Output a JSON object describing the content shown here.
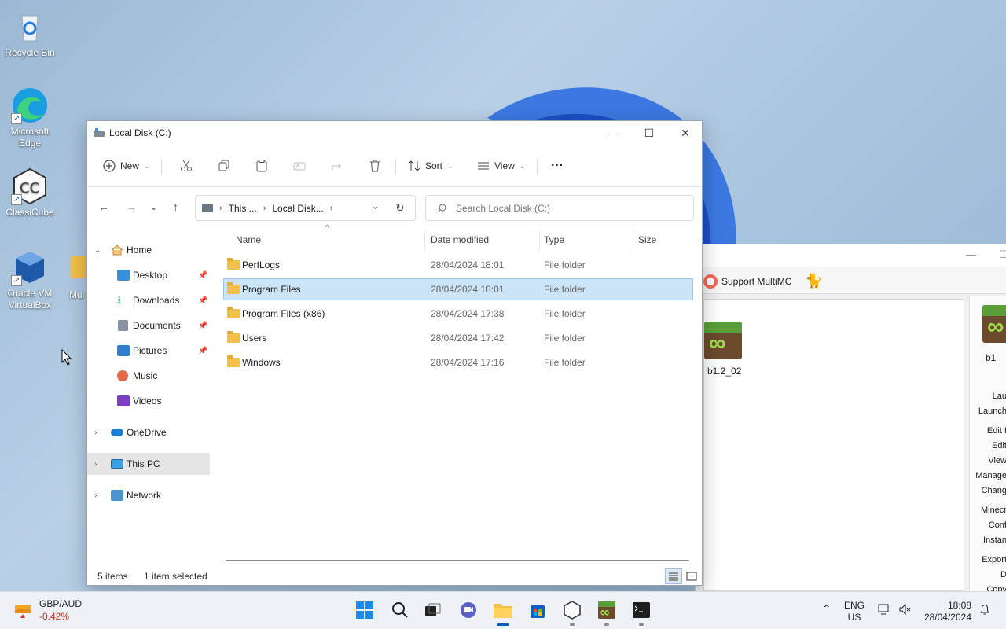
{
  "desktop": {
    "icons": [
      {
        "label": "Recycle Bin"
      },
      {
        "label": "Microsoft Edge"
      },
      {
        "label": "ClassiCube"
      },
      {
        "label": "Oracle VM VirtualBox"
      },
      {
        "label": "Mul"
      }
    ]
  },
  "multimc": {
    "support_label": "Support MultiMC",
    "instances": [
      {
        "label": "b1.2_02"
      },
      {
        "label": "b1"
      }
    ],
    "side_menu": [
      "Lau",
      "Launch",
      "Edit I",
      "Edit",
      "View",
      "Manage",
      "Chang",
      "Minecr",
      "Conf",
      "Instan",
      "Export",
      "D",
      "Copy"
    ]
  },
  "explorer": {
    "title": "Local Disk (C:)",
    "toolbar": {
      "new_label": "New",
      "sort_label": "Sort",
      "view_label": "View",
      "more_label": "···"
    },
    "address": {
      "crumbs": [
        "This ...",
        "Local Disk..."
      ]
    },
    "search": {
      "placeholder": "Search Local Disk (C:)"
    },
    "nav": {
      "home": "Home",
      "desktop": "Desktop",
      "downloads": "Downloads",
      "documents": "Documents",
      "pictures": "Pictures",
      "music": "Music",
      "videos": "Videos",
      "onedrive": "OneDrive",
      "thispc": "This PC",
      "network": "Network"
    },
    "columns": {
      "name": "Name",
      "date": "Date modified",
      "type": "Type",
      "size": "Size"
    },
    "files": [
      {
        "name": "PerfLogs",
        "date": "28/04/2024 18:01",
        "type": "File folder"
      },
      {
        "name": "Program Files",
        "date": "28/04/2024 18:01",
        "type": "File folder"
      },
      {
        "name": "Program Files (x86)",
        "date": "28/04/2024 17:38",
        "type": "File folder"
      },
      {
        "name": "Users",
        "date": "28/04/2024 17:42",
        "type": "File folder"
      },
      {
        "name": "Windows",
        "date": "28/04/2024 17:16",
        "type": "File folder"
      }
    ],
    "status": {
      "items": "5 items",
      "selected": "1 item selected"
    }
  },
  "taskbar": {
    "widget": {
      "title": "GBP/AUD",
      "change": "-0.42%"
    },
    "lang": {
      "top": "ENG",
      "bottom": "US"
    },
    "clock": {
      "time": "18:08",
      "date": "28/04/2024"
    }
  },
  "colors": {
    "accent": "#005fb8",
    "selection": "#cce4f7",
    "negative": "#c42b1c"
  }
}
